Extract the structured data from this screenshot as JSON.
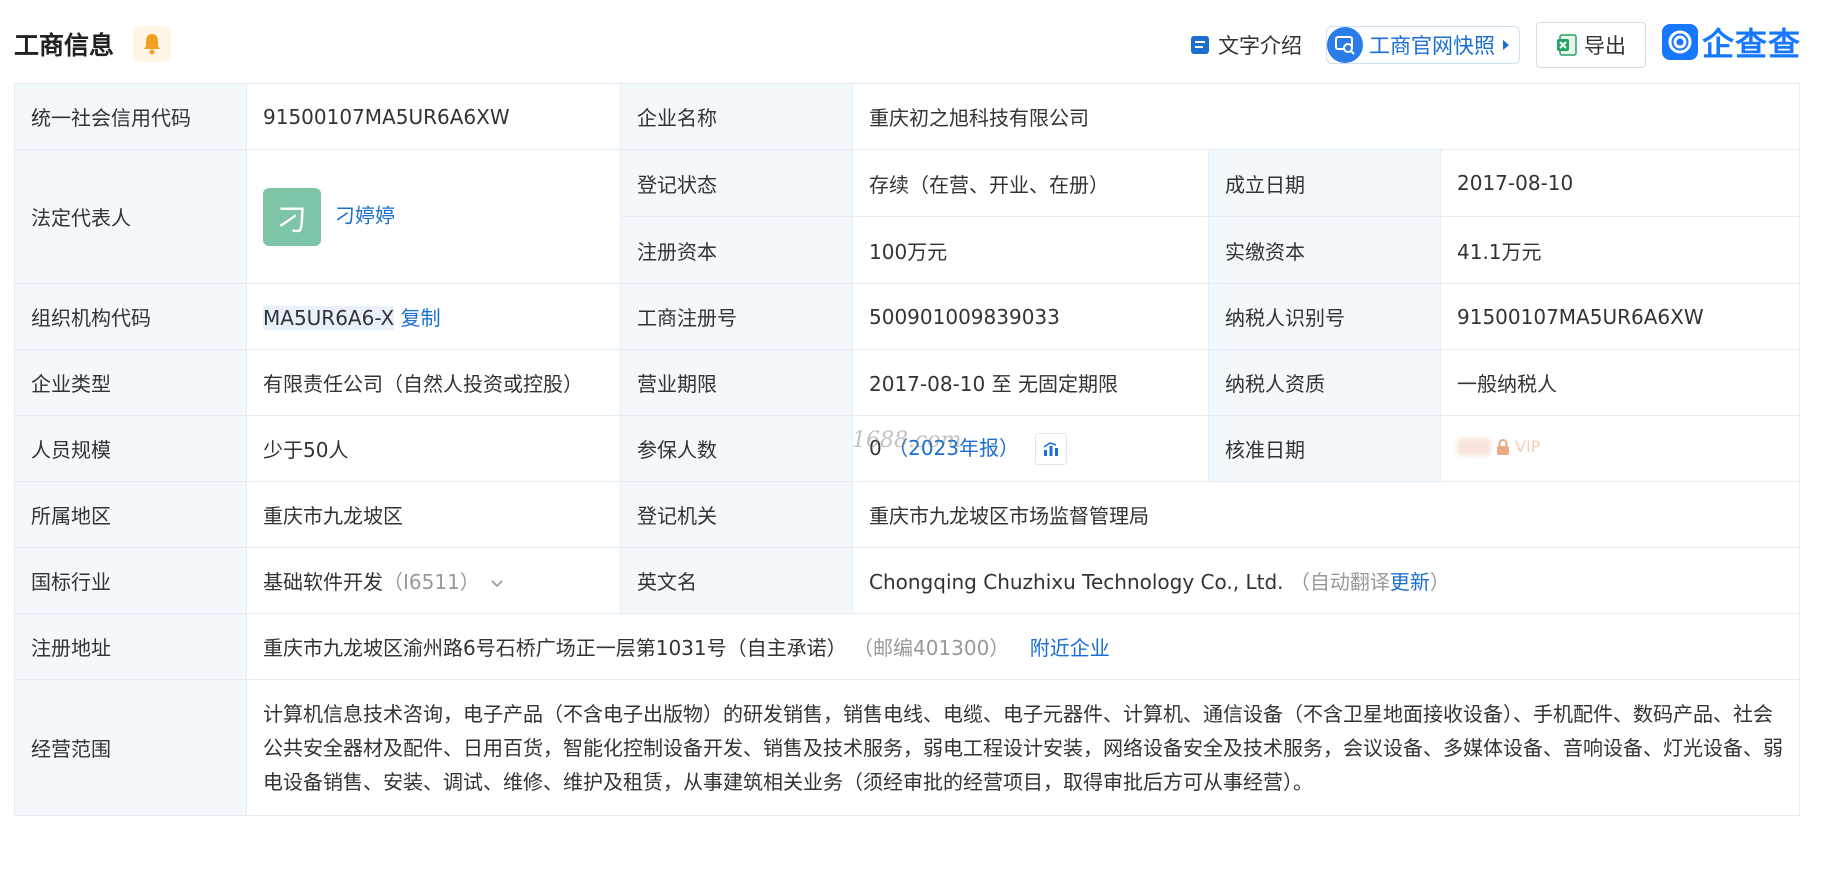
{
  "header": {
    "title": "工商信息",
    "intro_label": "文字介绍",
    "snapshot_label": "工商官网快照",
    "export_label": "导出",
    "logo_text": "企查查"
  },
  "watermark": "1688.com",
  "rows": {
    "credit_code": {
      "label": "统一社会信用代码",
      "value": "91500107MA5UR6A6XW"
    },
    "company_name": {
      "label": "企业名称",
      "value": "重庆初之旭科技有限公司"
    },
    "legal_rep": {
      "label": "法定代表人",
      "avatar_char": "刁",
      "value": "刁婷婷"
    },
    "status": {
      "label": "登记状态",
      "value": "存续（在营、开业、在册）"
    },
    "founded": {
      "label": "成立日期",
      "value": "2017-08-10"
    },
    "reg_capital": {
      "label": "注册资本",
      "value": "100万元"
    },
    "paid_capital": {
      "label": "实缴资本",
      "value": "41.1万元"
    },
    "org_code": {
      "label": "组织机构代码",
      "value": "MA5UR6A6-X",
      "copy_label": "复制"
    },
    "reg_no": {
      "label": "工商注册号",
      "value": "500901009839033"
    },
    "taxpayer_id": {
      "label": "纳税人识别号",
      "value": "91500107MA5UR6A6XW"
    },
    "company_type": {
      "label": "企业类型",
      "value": "有限责任公司（自然人投资或控股）"
    },
    "biz_term": {
      "label": "营业期限",
      "value": "2017-08-10 至 无固定期限"
    },
    "taxpayer_qual": {
      "label": "纳税人资质",
      "value": "一般纳税人"
    },
    "staff_size": {
      "label": "人员规模",
      "value": "少于50人"
    },
    "insured": {
      "label": "参保人数",
      "value": "0",
      "year_note": "（2023年报）"
    },
    "approval_date": {
      "label": "核准日期",
      "vip_label": "VIP"
    },
    "region": {
      "label": "所属地区",
      "value": "重庆市九龙坡区"
    },
    "authority": {
      "label": "登记机关",
      "value": "重庆市九龙坡区市场监督管理局"
    },
    "industry": {
      "label": "国标行业",
      "value": "基础软件开发",
      "code": "（I6511）"
    },
    "english_name": {
      "label": "英文名",
      "value": "Chongqing Chuzhixu Technology Co., Ltd.",
      "note_prefix": "（自动翻译",
      "update_label": "更新",
      "note_suffix": "）"
    },
    "address": {
      "label": "注册地址",
      "value": "重庆市九龙坡区渝州路6号石桥广场正一层第1031号（自主承诺）",
      "postcode": "（邮编401300）",
      "nearby_label": "附近企业"
    },
    "scope": {
      "label": "经营范围",
      "value": "计算机信息技术咨询，电子产品（不含电子出版物）的研发销售，销售电线、电缆、电子元器件、计算机、通信设备（不含卫星地面接收设备）、手机配件、数码产品、社会公共安全器材及配件、日用百货，智能化控制设备开发、销售及技术服务，弱电工程设计安装，网络设备安全及技术服务，会议设备、多媒体设备、音响设备、灯光设备、弱电设备销售、安装、调试、维修、维护及租赁，从事建筑相关业务（须经审批的经营项目，取得审批后方可从事经营）。"
    }
  },
  "colors": {
    "label_bg": "#f3f8fd",
    "link": "#1a6fd1",
    "brand": "#1677ff",
    "bell_bg": "#fff4e5",
    "bell": "#f0a020"
  }
}
